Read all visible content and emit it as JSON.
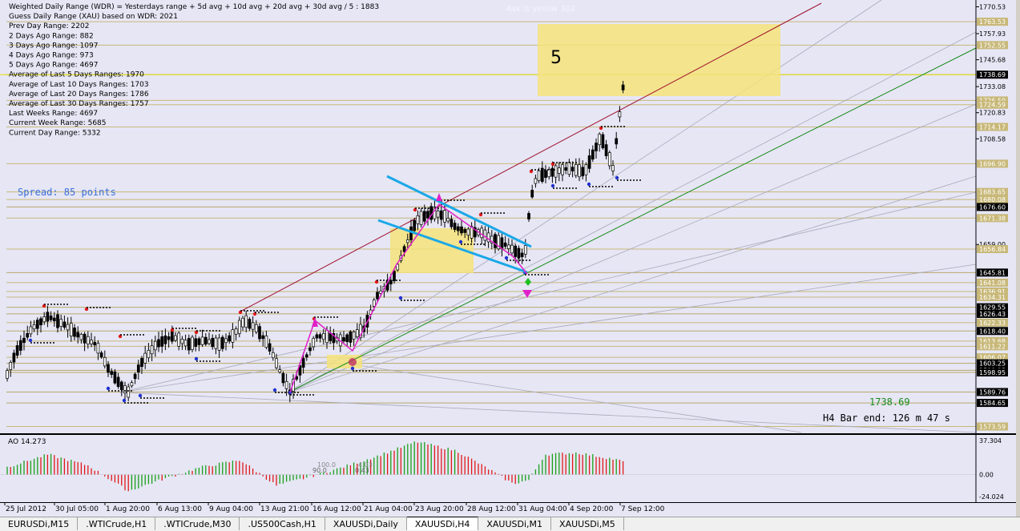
{
  "info_lines": [
    "Weighted Daily Range (WDR) = Yesterdays range + 5d avg + 10d avg + 20d avg + 30d avg / 5 : 1883",
    "Guess Daily Range (XAU) based on WDR: 2021",
    "Prev Day Range: 2202",
    "2 Days Ago Range: 882",
    "3 Days Ago Range: 1097",
    "4 Days Ago Range: 973",
    "5 Days Ago Range: 4697",
    "Average of Last 5 Days Ranges: 1970",
    "Average of Last 10 Days Ranges: 1703",
    "Average of Last 20 Days Ranges: 1786",
    "Average of Last 30 Days Ranges: 1757",
    "Last Weeks Range: 4697",
    "Current Week Range: 5685",
    "Current Day Range: 5332"
  ],
  "spread_text": "Spread: 85 points",
  "wave_label": "5",
  "top_faded_text": "Ask is yellow 302",
  "current_price_text": "1738.69",
  "bar_end_text": "H4 Bar end: 126 m 47 s",
  "price_axis_labels": [
    {
      "text": "1770.53",
      "price": 1770.53,
      "style": "plain"
    },
    {
      "text": "1763.53",
      "price": 1763.53,
      "style": "tan"
    },
    {
      "text": "1757.93",
      "price": 1757.93,
      "style": "plain"
    },
    {
      "text": "1752.55",
      "price": 1752.55,
      "style": "tan"
    },
    {
      "text": "1745.68",
      "price": 1745.68,
      "style": "plain"
    },
    {
      "text": "1738.69",
      "price": 1738.69,
      "style": "black"
    },
    {
      "text": "1733.08",
      "price": 1733.08,
      "style": "plain"
    },
    {
      "text": "1726.59",
      "price": 1726.59,
      "style": "tan"
    },
    {
      "text": "1724.59",
      "price": 1724.59,
      "style": "tan"
    },
    {
      "text": "1720.83",
      "price": 1720.83,
      "style": "plain"
    },
    {
      "text": "1714.17",
      "price": 1714.17,
      "style": "tan"
    },
    {
      "text": "1708.58",
      "price": 1708.58,
      "style": "plain"
    },
    {
      "text": "1696.90",
      "price": 1696.9,
      "style": "tan"
    },
    {
      "text": "1683.65",
      "price": 1683.65,
      "style": "tan"
    },
    {
      "text": "1680.08",
      "price": 1680.08,
      "style": "tan"
    },
    {
      "text": "1676.60",
      "price": 1676.6,
      "style": "black"
    },
    {
      "text": "1671.38",
      "price": 1671.38,
      "style": "tan"
    },
    {
      "text": "1659.00",
      "price": 1659.0,
      "style": "plain"
    },
    {
      "text": "1656.84",
      "price": 1656.84,
      "style": "tan"
    },
    {
      "text": "1645.81",
      "price": 1645.81,
      "style": "black"
    },
    {
      "text": "1641.08",
      "price": 1641.08,
      "style": "tan"
    },
    {
      "text": "1636.91",
      "price": 1636.91,
      "style": "tan"
    },
    {
      "text": "1634.31",
      "price": 1634.31,
      "style": "tan"
    },
    {
      "text": "1629.55",
      "price": 1629.55,
      "style": "black"
    },
    {
      "text": "1626.43",
      "price": 1626.43,
      "style": "black"
    },
    {
      "text": "1622.33",
      "price": 1622.33,
      "style": "tan"
    },
    {
      "text": "1618.40",
      "price": 1618.4,
      "style": "black"
    },
    {
      "text": "1613.68",
      "price": 1613.68,
      "style": "tan"
    },
    {
      "text": "1611.22",
      "price": 1611.22,
      "style": "tan"
    },
    {
      "text": "1606.07",
      "price": 1606.07,
      "style": "tan"
    },
    {
      "text": "1603.25",
      "price": 1603.25,
      "style": "black"
    },
    {
      "text": "1599.95",
      "price": 1599.95,
      "style": "black"
    },
    {
      "text": "1598.95",
      "price": 1598.95,
      "style": "black"
    },
    {
      "text": "1589.76",
      "price": 1589.76,
      "style": "black"
    },
    {
      "text": "1584.65",
      "price": 1584.65,
      "style": "black"
    },
    {
      "text": "1573.59",
      "price": 1573.59,
      "style": "tan"
    }
  ],
  "ao": {
    "label": "AO 14.273",
    "axis_labels": [
      {
        "text": "37.304",
        "value": 37.304
      },
      {
        "text": "0.00",
        "value": 0.0
      },
      {
        "text": "-24.024",
        "value": -24.024
      }
    ],
    "inline_labels": [
      "100.0",
      "90.0",
      "0.43",
      "4.03"
    ]
  },
  "time_labels": [
    "25 Jul 2012",
    "30 Jul 05:00",
    "1 Aug 20:00",
    "6 Aug 13:00",
    "9 Aug 04:00",
    "13 Aug 21:00",
    "16 Aug 12:00",
    "21 Aug 04:00",
    "23 Aug 20:00",
    "28 Aug 12:00",
    "31 Aug 04:00",
    "4 Sep 20:00",
    "7 Sep 12:00"
  ],
  "tabs": [
    {
      "label": "EURUSDi,M15",
      "active": false
    },
    {
      "label": ".WTICrude,H1",
      "active": false
    },
    {
      "label": ".WTICrude,M30",
      "active": false
    },
    {
      "label": ".US500Cash,H1",
      "active": false
    },
    {
      "label": "XAUUSDi,Daily",
      "active": false
    },
    {
      "label": "XAUUSDi,H4",
      "active": true
    },
    {
      "label": "XAUUSDi,M1",
      "active": false
    },
    {
      "label": "XAUUSDi,M5",
      "active": false
    }
  ],
  "colors": {
    "background": "#e6e6f5",
    "bull_candle": "#ffffff",
    "bear_candle": "#000000",
    "level_line": "#c8b878",
    "zone": "#f5e37a",
    "channel_upper": "#a0102a",
    "channel_lower": "#1a8c1a",
    "flag": "#1aa8e6",
    "zigzag": "#e020c8",
    "ao_up": "#18a018",
    "ao_down": "#e01818",
    "spread_text": "#3a6fd8",
    "current_price_text": "#1a8c1a"
  }
}
